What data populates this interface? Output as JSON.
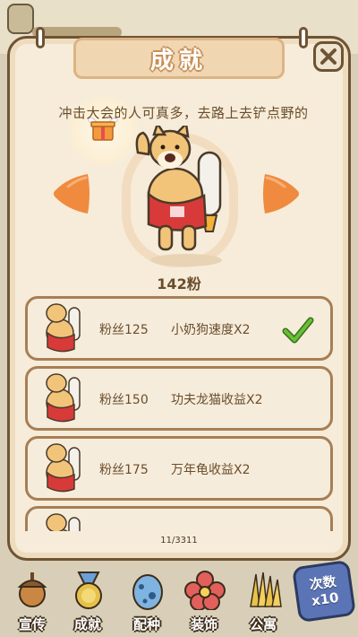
{
  "panel": {
    "title": "成就",
    "description": "冲击大会的人可真多，去路上去铲点野的",
    "fans_count": "142粉",
    "page_counter": "11/3311"
  },
  "achievements": [
    {
      "fans": "粉丝125",
      "reward": "小奶狗速度X2",
      "completed": true
    },
    {
      "fans": "粉丝150",
      "reward": "功夫龙猫收益X2",
      "completed": false
    },
    {
      "fans": "粉丝175",
      "reward": "万年龟收益X2",
      "completed": false
    },
    {
      "fans": "",
      "reward": "",
      "completed": false
    }
  ],
  "nav": {
    "items": [
      {
        "label": "宣传",
        "icon": "acorn-megaphone-icon"
      },
      {
        "label": "成就",
        "icon": "medal-icon"
      },
      {
        "label": "配种",
        "icon": "spotted-egg-icon"
      },
      {
        "label": "装饰",
        "icon": "flower-icon"
      },
      {
        "label": "公寓",
        "icon": "hay-bundle-icon"
      }
    ],
    "count_badge": {
      "title": "次数",
      "value": "x10"
    }
  },
  "colors": {
    "panel_bg": "#f6ecd9",
    "panel_border": "#6e5334",
    "arrow": "#f08a3e",
    "check": "#5aa62e",
    "badge": "#5b74b5"
  }
}
